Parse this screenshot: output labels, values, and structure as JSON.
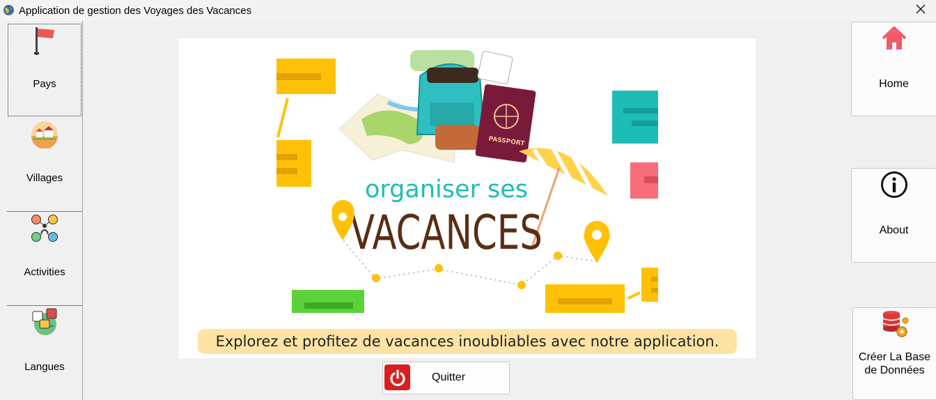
{
  "window": {
    "title": "Application de gestion des Voyages des Vacances",
    "app_icon": "globe-icon",
    "close_icon": "close-icon"
  },
  "sidebar": {
    "items": [
      {
        "label": "Pays",
        "icon": "flag-icon",
        "selected": true
      },
      {
        "label": "Villages",
        "icon": "village-icon",
        "selected": false
      },
      {
        "label": "Activities",
        "icon": "activities-icon",
        "selected": false
      },
      {
        "label": "Langues",
        "icon": "languages-icon",
        "selected": false
      }
    ]
  },
  "banner": {
    "headline_small": "organiser ses",
    "headline_big": "VACANCES",
    "passport_text": "PASSPORT",
    "tagline": "Explorez et profitez de vacances inoubliables avec notre application.",
    "colors": {
      "teal": "#1dbdb6",
      "brown": "#5a2d14",
      "yellow": "#ffc107",
      "green": "#5cd23a",
      "pink": "#f76e7a"
    }
  },
  "footer": {
    "quit_label": "Quitter",
    "quit_icon": "power-icon",
    "quit_color": "#d71f1f"
  },
  "right_panel": {
    "home_label": "Home",
    "home_icon": "home-icon",
    "home_icon_color": "#f25a6a",
    "about_label": "About",
    "about_icon": "info-icon",
    "db_label_line1": "Créer La Base",
    "db_label_line2": "de Données",
    "db_icon": "database-gear-icon"
  }
}
